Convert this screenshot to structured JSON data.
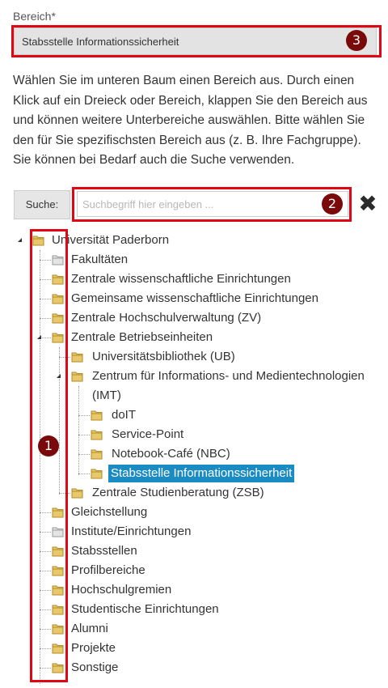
{
  "field": {
    "label": "Bereich*",
    "selected_value": "Stabsstelle Informationssicherheit"
  },
  "instructions": "Wählen Sie im unteren Baum einen Bereich aus. Durch einen Klick auf ein Dreieck oder Bereich, klappen Sie den Bereich aus und können weitere Unterbereiche auswählen. Bitte wählen Sie den für Sie spezifischsten Bereich aus (z. B. Ihre Fachgruppe). Sie können bei Bedarf auch die Suche verwenden.",
  "search": {
    "label": "Suche:",
    "placeholder": "Suchbegriff hier eingeben ..."
  },
  "badges": {
    "tree": "1",
    "search": "2",
    "select": "3"
  },
  "colors": {
    "highlight_box": "#e10613",
    "badge": "#7a0a0a",
    "selected_node": "#1b8bc3",
    "select_bg": "#e3e3e3"
  },
  "tree": {
    "root": "Universität Paderborn",
    "level1": [
      "Fakultäten",
      "Zentrale wissenschaftliche Einrichtungen",
      "Gemeinsame wissenschaftliche Einrichtungen",
      "Zentrale Hochschulverwaltung (ZV)",
      "Zentrale Betriebseinheiten",
      "Gleichstellung",
      "Institute/Einrichtungen",
      "Stabsstellen",
      "Profilbereiche",
      "Hochschulgremien",
      "Studentische Einrichtungen",
      "Alumni",
      "Projekte",
      "Sonstige"
    ],
    "betriebseinheiten": [
      "Universitätsbibliothek (UB)",
      "Zentrum für Informations- und Medientechnologien",
      "Zentrale Studienberatung (ZSB)"
    ],
    "imt_suffix": "(IMT)",
    "imt": [
      "doIT",
      "Service-Point",
      "Notebook-Café (NBC)",
      "Stabsstelle Informationssicherheit"
    ]
  }
}
